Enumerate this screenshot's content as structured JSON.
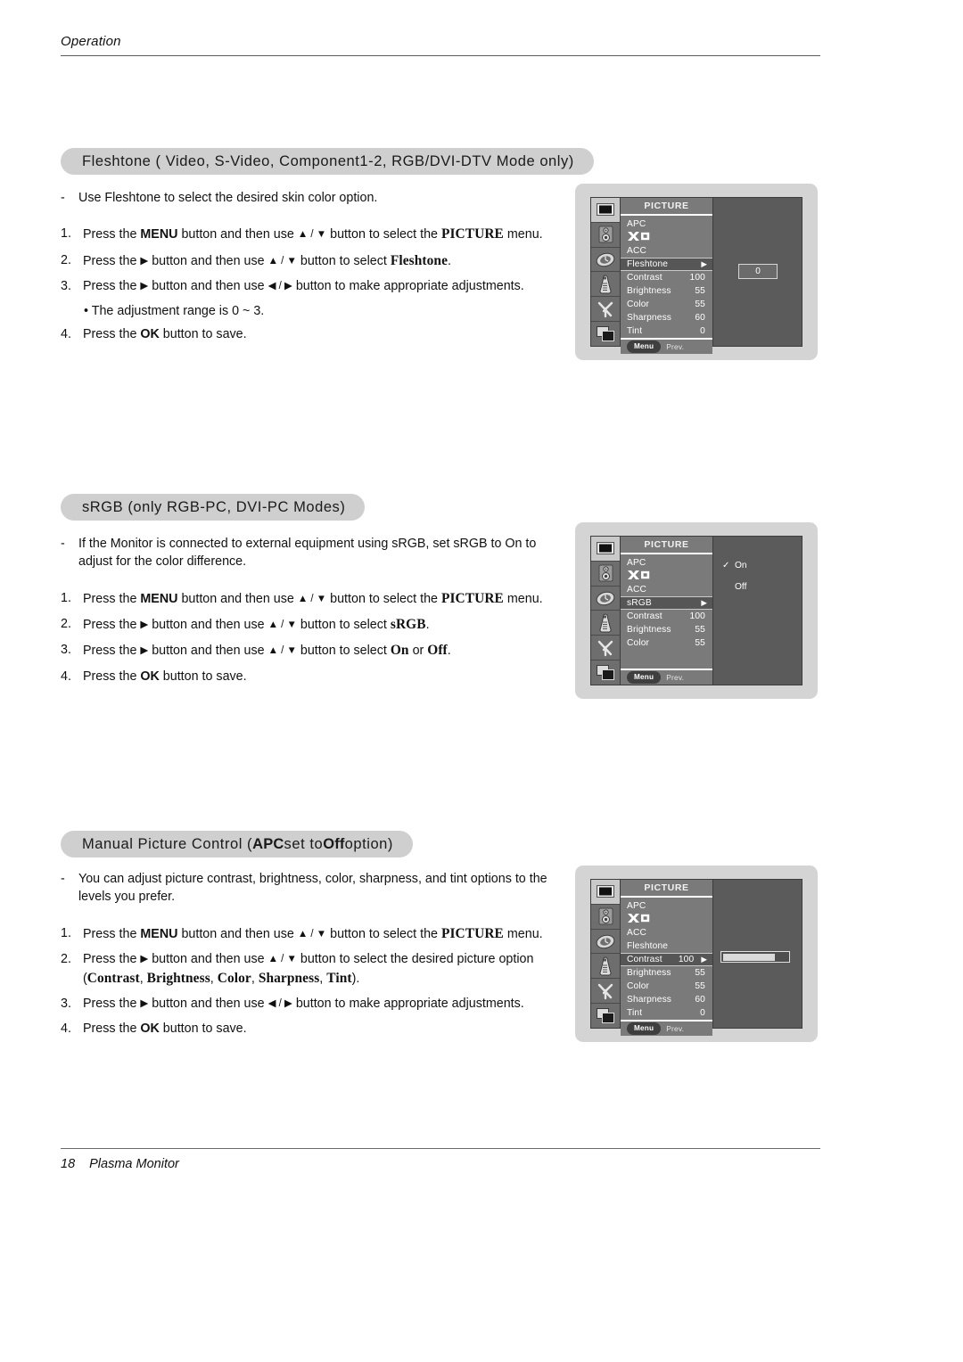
{
  "header": {
    "running_head": "Operation"
  },
  "footer": {
    "page_number": "18",
    "document_title": "Plasma Monitor"
  },
  "sections": [
    {
      "id": "fleshtone",
      "heading_parts": {
        "pre": "Fleshtone ( Video, S-Video, Component1-2, RGB/DVI-DTV Mode only)"
      },
      "lead_dash": "-",
      "lead": "Use Fleshtone to select the desired skin color option.",
      "steps": [
        {
          "num": "1.",
          "pre": "Press the ",
          "b1": "MENU",
          "mid": " button and then use ",
          "arrows": "▲ / ▼",
          "mid2": " button to select the ",
          "b2": "PICTURE",
          "post": " menu."
        },
        {
          "num": "2.",
          "pre": "Press the ",
          "arrow_single": "▶",
          "mid": " button and then use ",
          "arrows": "▲ / ▼",
          "mid2": " button to select ",
          "b2": "Fleshtone",
          "post": "."
        },
        {
          "num": "3.",
          "pre": "Press the ",
          "arrow_single": "▶",
          "mid": " button and then use ",
          "arrows": "◀ / ▶",
          "mid2": " button to make appropriate adjustments.",
          "b2": "",
          "post": ""
        }
      ],
      "sub_note": "• The adjustment range is 0 ~ 3.",
      "final_step": {
        "num": "4.",
        "pre": "Press the ",
        "b1": "OK",
        "post": " button to save."
      }
    },
    {
      "id": "srgb",
      "heading_parts": {
        "pre": "sRGB (only RGB-PC, DVI-PC Modes)"
      },
      "lead_dash": "-",
      "lead": "If the Monitor is connected to external equipment using sRGB, set sRGB to On to adjust for the color difference.",
      "steps": [
        {
          "num": "1.",
          "pre": "Press the ",
          "b1": "MENU",
          "mid": " button and then use ",
          "arrows": "▲ / ▼",
          "mid2": " button to select the ",
          "b2": "PICTURE",
          "post": " menu."
        },
        {
          "num": "2.",
          "pre": "Press the ",
          "arrow_single": "▶",
          "mid": " button and then use ",
          "arrows": "▲ / ▼",
          "mid2": " button to select ",
          "b2": "sRGB",
          "post": "."
        },
        {
          "num": "3.",
          "pre": "Press the ",
          "arrow_single": "▶",
          "mid": " button and then use ",
          "arrows": "▲ / ▼",
          "mid2": " button to select ",
          "b2": "On",
          "mid3": " or ",
          "b3": "Off",
          "post": "."
        }
      ],
      "final_step": {
        "num": "4.",
        "pre": "Press the ",
        "b1": "OK",
        "post": " button to save."
      }
    },
    {
      "id": "manual-picture",
      "heading_parts": {
        "a": "Manual Picture Control (",
        "b1": "APC",
        "b": " set to ",
        "b2": "Off",
        "c": " option)"
      },
      "lead_dash": "-",
      "lead": "You can adjust picture contrast, brightness, color, sharpness, and tint options to the levels you prefer.",
      "steps": [
        {
          "num": "1.",
          "pre": "Press the ",
          "b1": "MENU",
          "mid": " button and then use ",
          "arrows": "▲ / ▼",
          "mid2": " button to select the ",
          "b2": "PICTURE",
          "post": " menu."
        },
        {
          "num": "2.",
          "pre": "Press the ",
          "arrow_single": "▶",
          "mid": " button and then use ",
          "arrows": "▲ / ▼",
          "mid2": " button to select the desired picture option",
          "post": "",
          "second_line": {
            "open": "(",
            "items": [
              "Contrast",
              "Brightness",
              "Color",
              "Sharpness",
              "Tint"
            ],
            "close": ")."
          }
        },
        {
          "num": "3.",
          "pre": "Press the ",
          "arrow_single": "▶",
          "mid": " button and then use ",
          "arrows": "◀ / ▶",
          "mid2": " button to make appropriate adjustments.",
          "b2": "",
          "post": ""
        }
      ],
      "final_step": {
        "num": "4.",
        "pre": "Press the ",
        "b1": "OK",
        "post": " button to save."
      }
    }
  ],
  "osd_common": {
    "menu_title": "PICTURE",
    "footer_menu_label": "Menu",
    "footer_prev_label": "Prev.",
    "rail_icons": [
      "picture-icon",
      "audio-speaker-icon",
      "clock-timer-icon",
      "remote-control-icon",
      "special-tools-icon",
      "screen-windows-icon"
    ],
    "xd_logo_label": "XD"
  },
  "osd_fleshtone": {
    "rows": [
      {
        "label": "APC",
        "value": "",
        "caret": "",
        "highlight": false
      },
      {
        "label": "XD",
        "value": "",
        "caret": "",
        "highlight": false,
        "logo": true
      },
      {
        "label": "ACC",
        "value": "",
        "caret": "",
        "highlight": false
      },
      {
        "label": "Fleshtone",
        "value": "",
        "caret": "▶",
        "highlight": true
      },
      {
        "label": "Contrast",
        "value": "100",
        "caret": "",
        "highlight": false
      },
      {
        "label": "Brightness",
        "value": "55",
        "caret": "",
        "highlight": false
      },
      {
        "label": "Color",
        "value": "55",
        "caret": "",
        "highlight": false
      },
      {
        "label": "Sharpness",
        "value": "60",
        "caret": "",
        "highlight": false
      },
      {
        "label": "Tint",
        "value": "0",
        "caret": "",
        "highlight": false
      }
    ],
    "value_chip": "0"
  },
  "osd_srgb": {
    "rows": [
      {
        "label": "APC",
        "value": "",
        "caret": "",
        "highlight": false
      },
      {
        "label": "XD",
        "value": "",
        "caret": "",
        "highlight": false,
        "logo": true
      },
      {
        "label": "ACC",
        "value": "",
        "caret": "",
        "highlight": false
      },
      {
        "label": "sRGB",
        "value": "",
        "caret": "▶",
        "highlight": true
      },
      {
        "label": "Contrast",
        "value": "100",
        "caret": "",
        "highlight": false
      },
      {
        "label": "Brightness",
        "value": "55",
        "caret": "",
        "highlight": false
      },
      {
        "label": "Color",
        "value": "55",
        "caret": "",
        "highlight": false
      }
    ],
    "options": [
      {
        "check": "✓",
        "label": "On",
        "selected": true
      },
      {
        "check": "",
        "label": "Off",
        "selected": false
      }
    ]
  },
  "osd_manual": {
    "rows": [
      {
        "label": "APC",
        "value": "",
        "caret": "",
        "highlight": false
      },
      {
        "label": "XD",
        "value": "",
        "caret": "",
        "highlight": false,
        "logo": true
      },
      {
        "label": "ACC",
        "value": "",
        "caret": "",
        "highlight": false
      },
      {
        "label": "Fleshtone",
        "value": "",
        "caret": "",
        "highlight": false
      },
      {
        "label": "Contrast",
        "value": "100",
        "caret": "▶",
        "highlight": true
      },
      {
        "label": "Brightness",
        "value": "55",
        "caret": "",
        "highlight": false
      },
      {
        "label": "Color",
        "value": "55",
        "caret": "",
        "highlight": false
      },
      {
        "label": "Sharpness",
        "value": "60",
        "caret": "",
        "highlight": false
      },
      {
        "label": "Tint",
        "value": "0",
        "caret": "",
        "highlight": false
      }
    ],
    "slider_percent": 80
  }
}
